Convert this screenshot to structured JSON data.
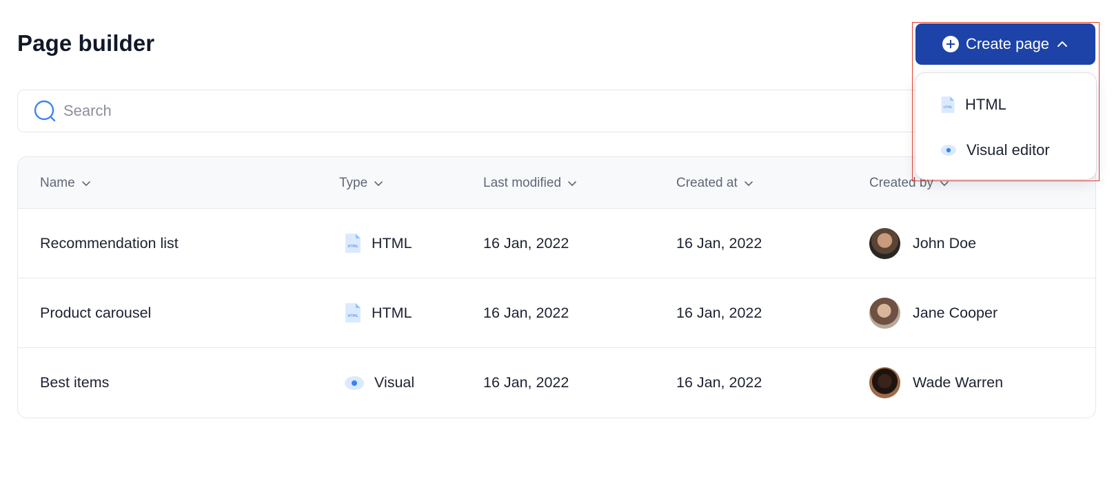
{
  "header": {
    "title": "Page builder",
    "create_label": "Create page"
  },
  "search": {
    "placeholder": "Search",
    "value": ""
  },
  "dropdown": {
    "items": [
      {
        "label": "HTML",
        "icon": "file-html-icon"
      },
      {
        "label": "Visual editor",
        "icon": "eye-icon"
      }
    ]
  },
  "table": {
    "columns": [
      "Name",
      "Type",
      "Last modified",
      "Created at",
      "Created by"
    ],
    "rows": [
      {
        "name": "Recommendation list",
        "type": "HTML",
        "type_icon": "file-html-icon",
        "modified": "16 Jan, 2022",
        "created": "16 Jan, 2022",
        "author": "John Doe"
      },
      {
        "name": "Product carousel",
        "type": "HTML",
        "type_icon": "file-html-icon",
        "modified": "16 Jan, 2022",
        "created": "16 Jan, 2022",
        "author": "Jane Cooper"
      },
      {
        "name": "Best items",
        "type": "Visual",
        "type_icon": "eye-icon",
        "modified": "16 Jan, 2022",
        "created": "16 Jan, 2022",
        "author": "Wade Warren"
      }
    ]
  },
  "colors": {
    "primary": "#1d43a8",
    "icon_blue": "#3b82f6",
    "highlight": "#e23b2e"
  }
}
